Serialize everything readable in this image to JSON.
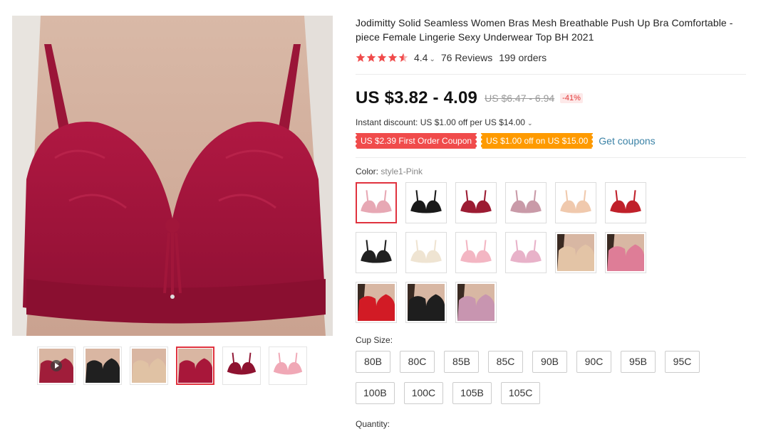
{
  "product": {
    "title": "Jodimitty Solid Seamless Women Bras Mesh Breathable Push Up Bra Comfortable -piece Female Lingerie Sexy Underwear Top BH 2021",
    "rating": "4.4",
    "reviews": "76 Reviews",
    "orders": "199 orders",
    "star_color": "#f04b4b"
  },
  "pricing": {
    "price": "US $3.82 - 4.09",
    "original_price": "US $6.47 - 6.94",
    "discount": "-41%",
    "instant_discount": "Instant discount: US $1.00 off per US $14.00"
  },
  "coupons": {
    "first_order": "US $2.39 First Order Coupon",
    "off": "US $1.00 off on US $15.00",
    "get_coupons": "Get coupons"
  },
  "color": {
    "label": "Color:",
    "selected": "style1-Pink",
    "swatches": [
      {
        "name": "pink",
        "color": "#e7a8b4"
      },
      {
        "name": "black",
        "color": "#1a1a1a"
      },
      {
        "name": "wine",
        "color": "#9c1c33"
      },
      {
        "name": "mauve",
        "color": "#c99aa8"
      },
      {
        "name": "nude",
        "color": "#f0c9ad"
      },
      {
        "name": "red",
        "color": "#c0202a"
      },
      {
        "name": "black-lace",
        "color": "#202020"
      },
      {
        "name": "beige",
        "color": "#efe4d2"
      },
      {
        "name": "light-pink",
        "color": "#f3b6c3"
      },
      {
        "name": "pale-pink",
        "color": "#e8b2c9"
      },
      {
        "name": "model-nude",
        "color": "#e3c4a6"
      },
      {
        "name": "model-pink",
        "color": "#de7d97"
      },
      {
        "name": "model-red",
        "color": "#d21b25"
      },
      {
        "name": "model-black",
        "color": "#1e1e1e"
      },
      {
        "name": "model-mauve",
        "color": "#c895b0"
      }
    ]
  },
  "cup_size": {
    "label": "Cup Size:",
    "options": [
      "80B",
      "80C",
      "85B",
      "85C",
      "90B",
      "90C",
      "95B",
      "95C",
      "100B",
      "100C",
      "105B",
      "105C"
    ]
  },
  "quantity": {
    "label": "Quantity:"
  },
  "gallery": {
    "thumbnails": [
      {
        "name": "video",
        "color": "#a01d3a"
      },
      {
        "name": "black",
        "color": "#202020"
      },
      {
        "name": "nude",
        "color": "#e0c2a4"
      },
      {
        "name": "wine",
        "color": "#a8173a"
      },
      {
        "name": "wine-flat",
        "color": "#8e1230"
      },
      {
        "name": "pink-flat",
        "color": "#f0a8b6"
      }
    ]
  },
  "colors": {
    "accent": "#e0323e",
    "link": "#3b82a6",
    "coupon_red": "#f04b4b",
    "coupon_orange": "#fe9a00"
  }
}
